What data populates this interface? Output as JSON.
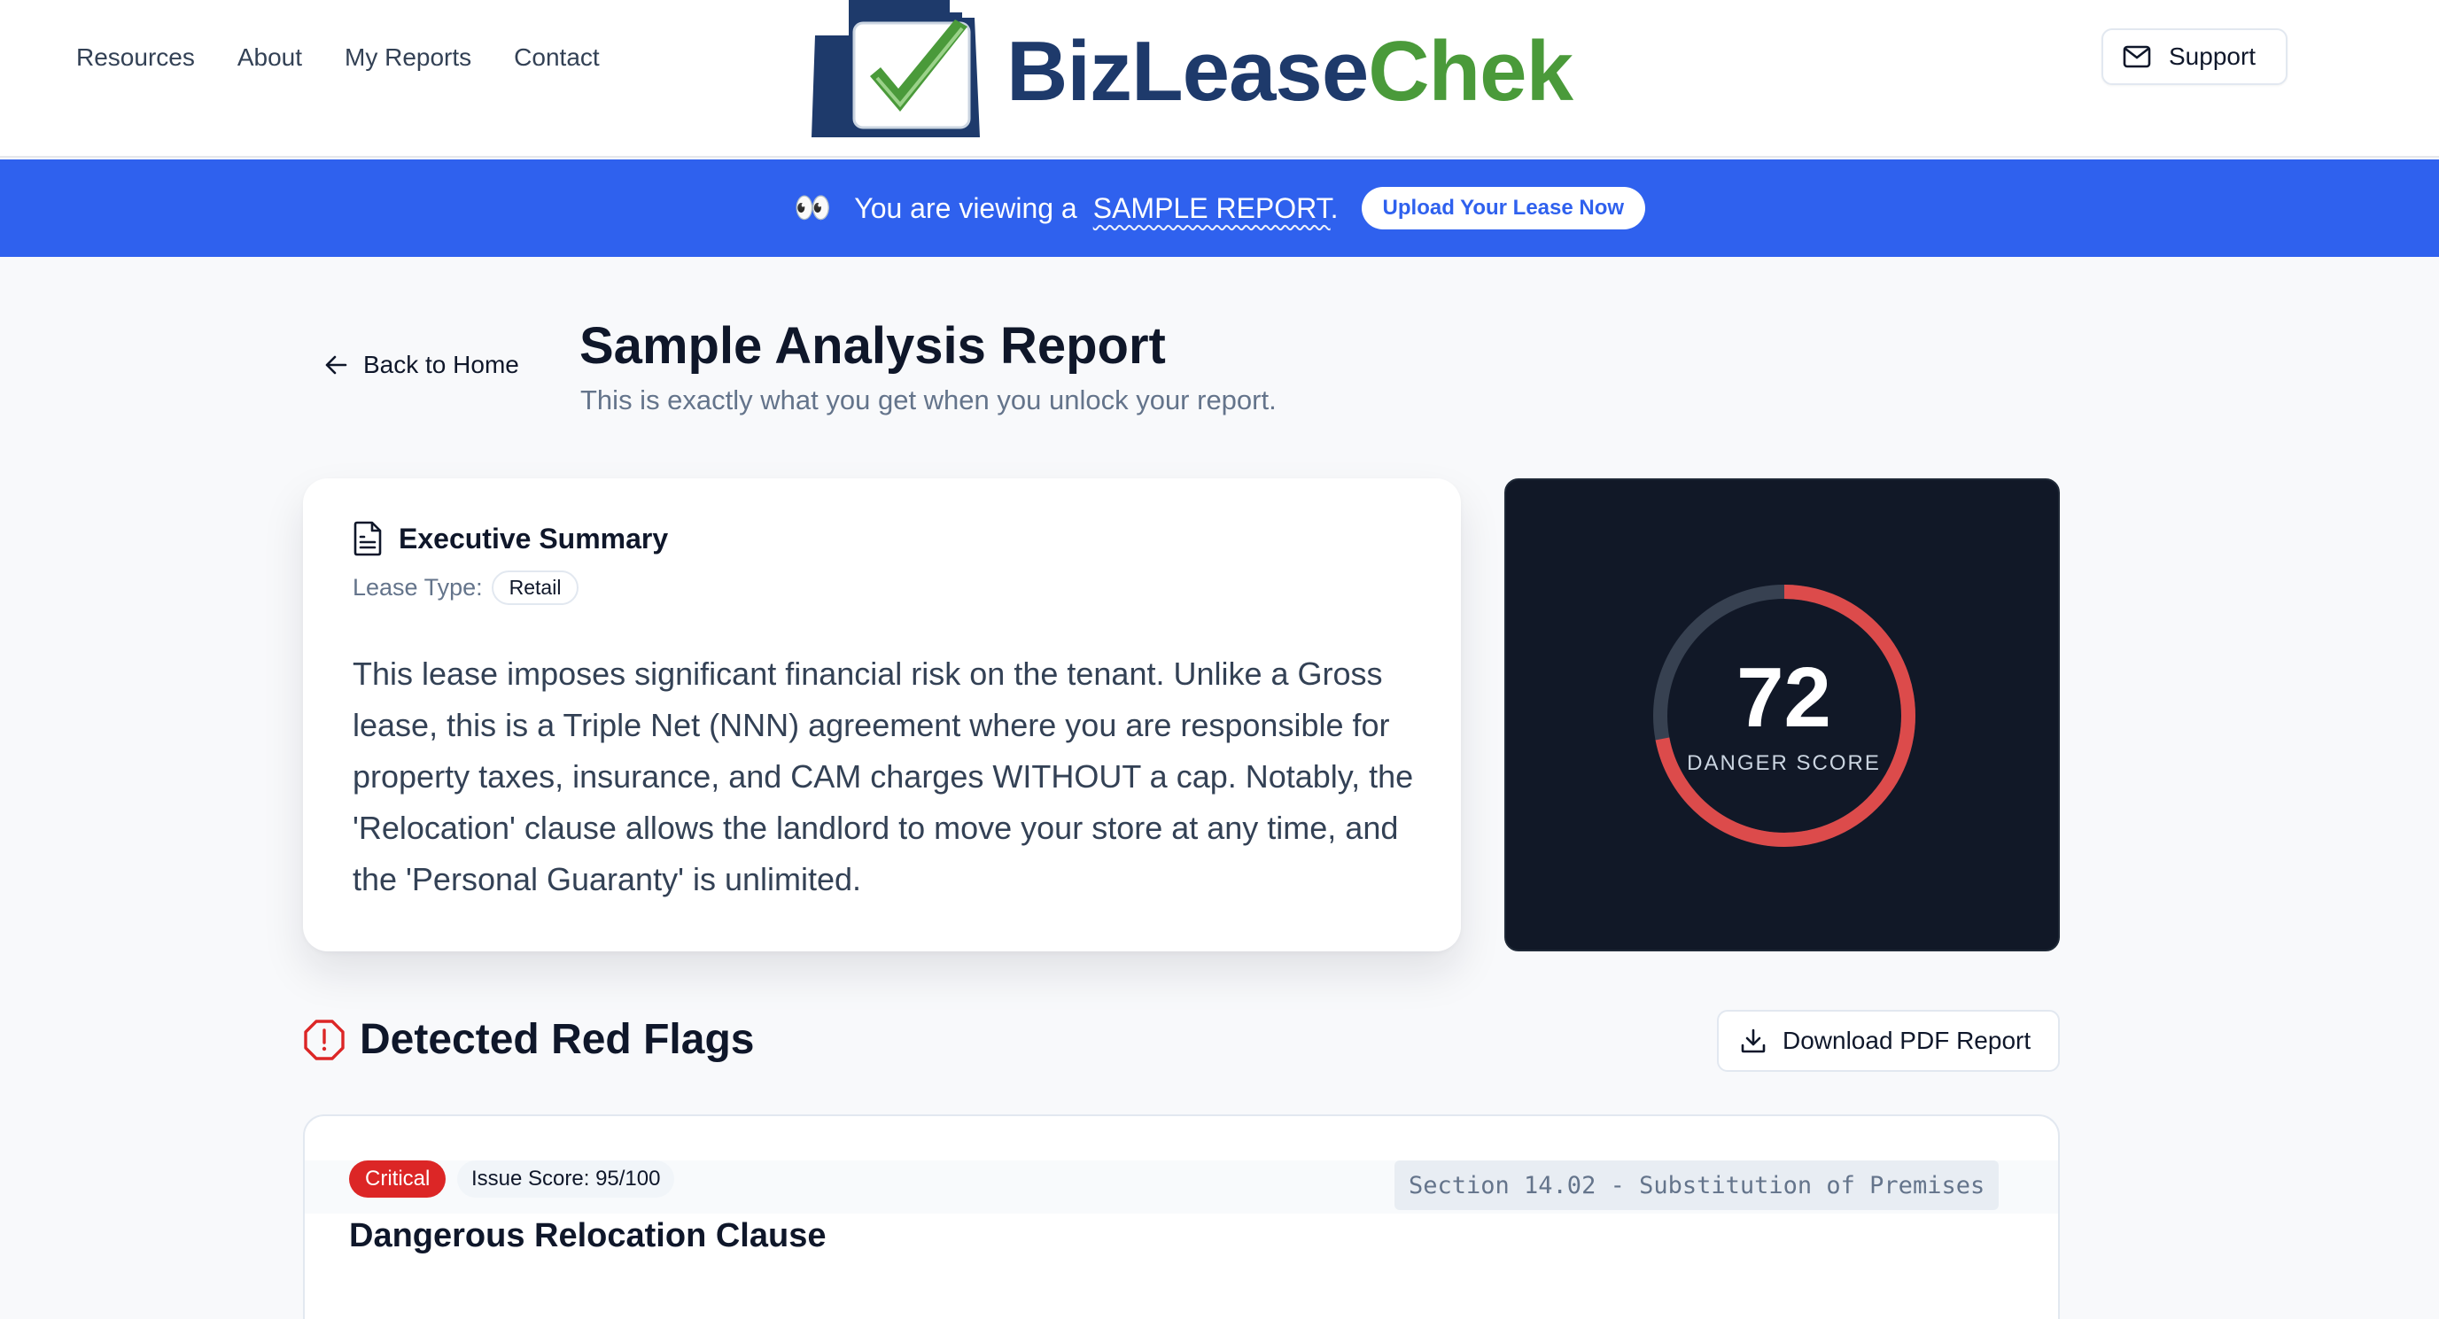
{
  "nav": {
    "links": [
      "Resources",
      "About",
      "My Reports",
      "Contact"
    ],
    "support_label": "Support"
  },
  "logo": {
    "text_part1": "BizLease",
    "text_part2": "Chek"
  },
  "banner": {
    "eyes": "👀",
    "prefix": "You are viewing a",
    "sample": "SAMPLE REPORT",
    "suffix": ".",
    "upload_label": "Upload Your Lease Now"
  },
  "header": {
    "back_label": "Back to Home",
    "title": "Sample Analysis Report",
    "subtitle": "This is exactly what you get when you unlock your report."
  },
  "summary": {
    "title": "Executive Summary",
    "lease_type_label": "Lease Type:",
    "lease_type_value": "Retail",
    "body": "This lease imposes significant financial risk on the tenant. Unlike a Gross lease, this is a Triple Net (NNN) agreement where you are responsible for property taxes, insurance, and CAM charges WITHOUT a cap. Notably, the 'Relocation' clause allows the landlord to move your store at any time, and the 'Personal Guaranty' is unlimited."
  },
  "score": {
    "value": "72",
    "label": "DANGER SCORE",
    "fraction": 0.72,
    "ring_color": "#dc4b4b",
    "track_color": "#374151"
  },
  "flags": {
    "title": "Detected Red Flags",
    "download_label": "Download PDF Report",
    "items": [
      {
        "severity": "Critical",
        "issue_score": "Issue Score: 95/100",
        "section": "Section 14.02 - Substitution of Premises",
        "title": "Dangerous Relocation Clause"
      }
    ]
  },
  "colors": {
    "banner": "#2f61ee",
    "critical": "#dc2626",
    "logo_blue": "#1e3a6b",
    "logo_green": "#4a9a3a"
  },
  "icons": {
    "support": "mail-icon",
    "back": "arrow-left-icon",
    "summary": "document-icon",
    "flags": "alert-octagon-icon",
    "download": "download-icon"
  }
}
